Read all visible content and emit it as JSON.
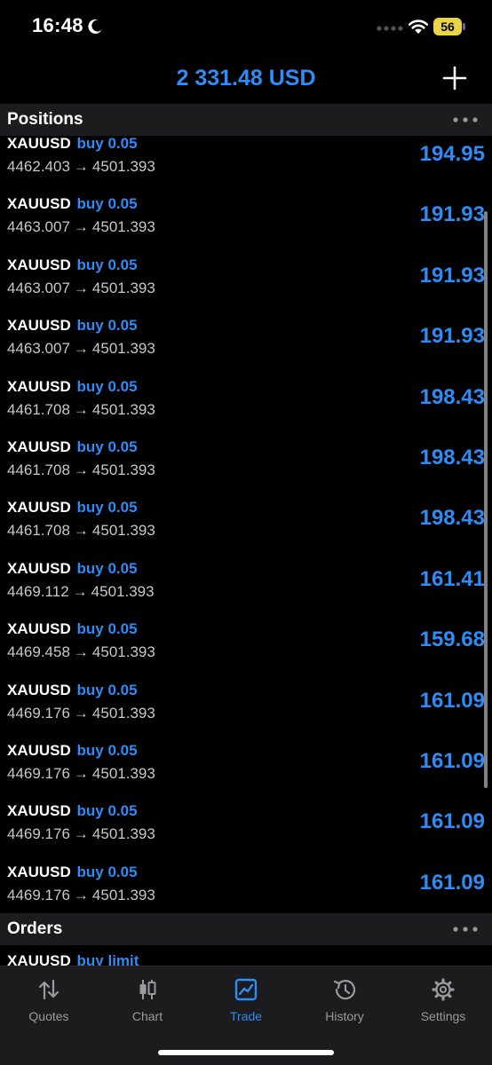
{
  "status_bar": {
    "time": "16:48",
    "battery_level": "56",
    "icons": [
      "moon-icon",
      "signal-icon",
      "wifi-icon",
      "battery-icon"
    ],
    "battery_color": "#e8d44a"
  },
  "header": {
    "balance": "2 331.48 USD",
    "add_icon": "plus-icon"
  },
  "colors": {
    "accent": "#2d8cf5",
    "background": "#000000",
    "section_background": "#1c1c1e",
    "secondary_text": "#c7c7cc"
  },
  "positions": {
    "title": "Positions",
    "rows": [
      {
        "symbol": "XAUUSD",
        "side": "buy 0.05",
        "open_price": "4462.403",
        "arrow": "→",
        "current_price": "4501.393",
        "profit": "194.95"
      },
      {
        "symbol": "XAUUSD",
        "side": "buy 0.05",
        "open_price": "4463.007",
        "arrow": "→",
        "current_price": "4501.393",
        "profit": "191.93"
      },
      {
        "symbol": "XAUUSD",
        "side": "buy 0.05",
        "open_price": "4463.007",
        "arrow": "→",
        "current_price": "4501.393",
        "profit": "191.93"
      },
      {
        "symbol": "XAUUSD",
        "side": "buy 0.05",
        "open_price": "4463.007",
        "arrow": "→",
        "current_price": "4501.393",
        "profit": "191.93"
      },
      {
        "symbol": "XAUUSD",
        "side": "buy 0.05",
        "open_price": "4461.708",
        "arrow": "→",
        "current_price": "4501.393",
        "profit": "198.43"
      },
      {
        "symbol": "XAUUSD",
        "side": "buy 0.05",
        "open_price": "4461.708",
        "arrow": "→",
        "current_price": "4501.393",
        "profit": "198.43"
      },
      {
        "symbol": "XAUUSD",
        "side": "buy 0.05",
        "open_price": "4461.708",
        "arrow": "→",
        "current_price": "4501.393",
        "profit": "198.43"
      },
      {
        "symbol": "XAUUSD",
        "side": "buy 0.05",
        "open_price": "4469.112",
        "arrow": "→",
        "current_price": "4501.393",
        "profit": "161.41"
      },
      {
        "symbol": "XAUUSD",
        "side": "buy 0.05",
        "open_price": "4469.458",
        "arrow": "→",
        "current_price": "4501.393",
        "profit": "159.68"
      },
      {
        "symbol": "XAUUSD",
        "side": "buy 0.05",
        "open_price": "4469.176",
        "arrow": "→",
        "current_price": "4501.393",
        "profit": "161.09"
      },
      {
        "symbol": "XAUUSD",
        "side": "buy 0.05",
        "open_price": "4469.176",
        "arrow": "→",
        "current_price": "4501.393",
        "profit": "161.09"
      },
      {
        "symbol": "XAUUSD",
        "side": "buy 0.05",
        "open_price": "4469.176",
        "arrow": "→",
        "current_price": "4501.393",
        "profit": "161.09"
      },
      {
        "symbol": "XAUUSD",
        "side": "buy 0.05",
        "open_price": "4469.176",
        "arrow": "→",
        "current_price": "4501.393",
        "profit": "161.09"
      }
    ]
  },
  "orders": {
    "title": "Orders",
    "first_row": {
      "symbol": "XAUUSD",
      "side": "buy limit"
    }
  },
  "tab_bar": {
    "tabs": [
      {
        "label": "Quotes",
        "icon": "quotes-icon",
        "active": false
      },
      {
        "label": "Chart",
        "icon": "candlestick-icon",
        "active": false
      },
      {
        "label": "Trade",
        "icon": "trade-chart-icon",
        "active": true
      },
      {
        "label": "History",
        "icon": "history-icon",
        "active": false
      },
      {
        "label": "Settings",
        "icon": "gear-icon",
        "active": false
      }
    ]
  }
}
